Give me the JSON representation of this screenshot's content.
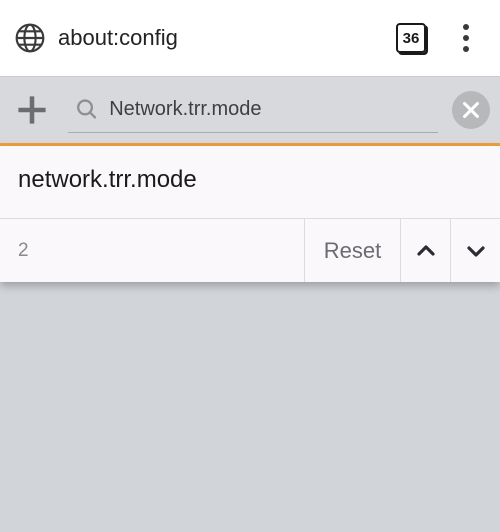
{
  "chrome": {
    "url": "about:config",
    "tab_count": "36"
  },
  "toolbar": {
    "search_value": "Network.trr.mode"
  },
  "result": {
    "name": "network.trr.mode",
    "value": "2",
    "reset_label": "Reset"
  }
}
